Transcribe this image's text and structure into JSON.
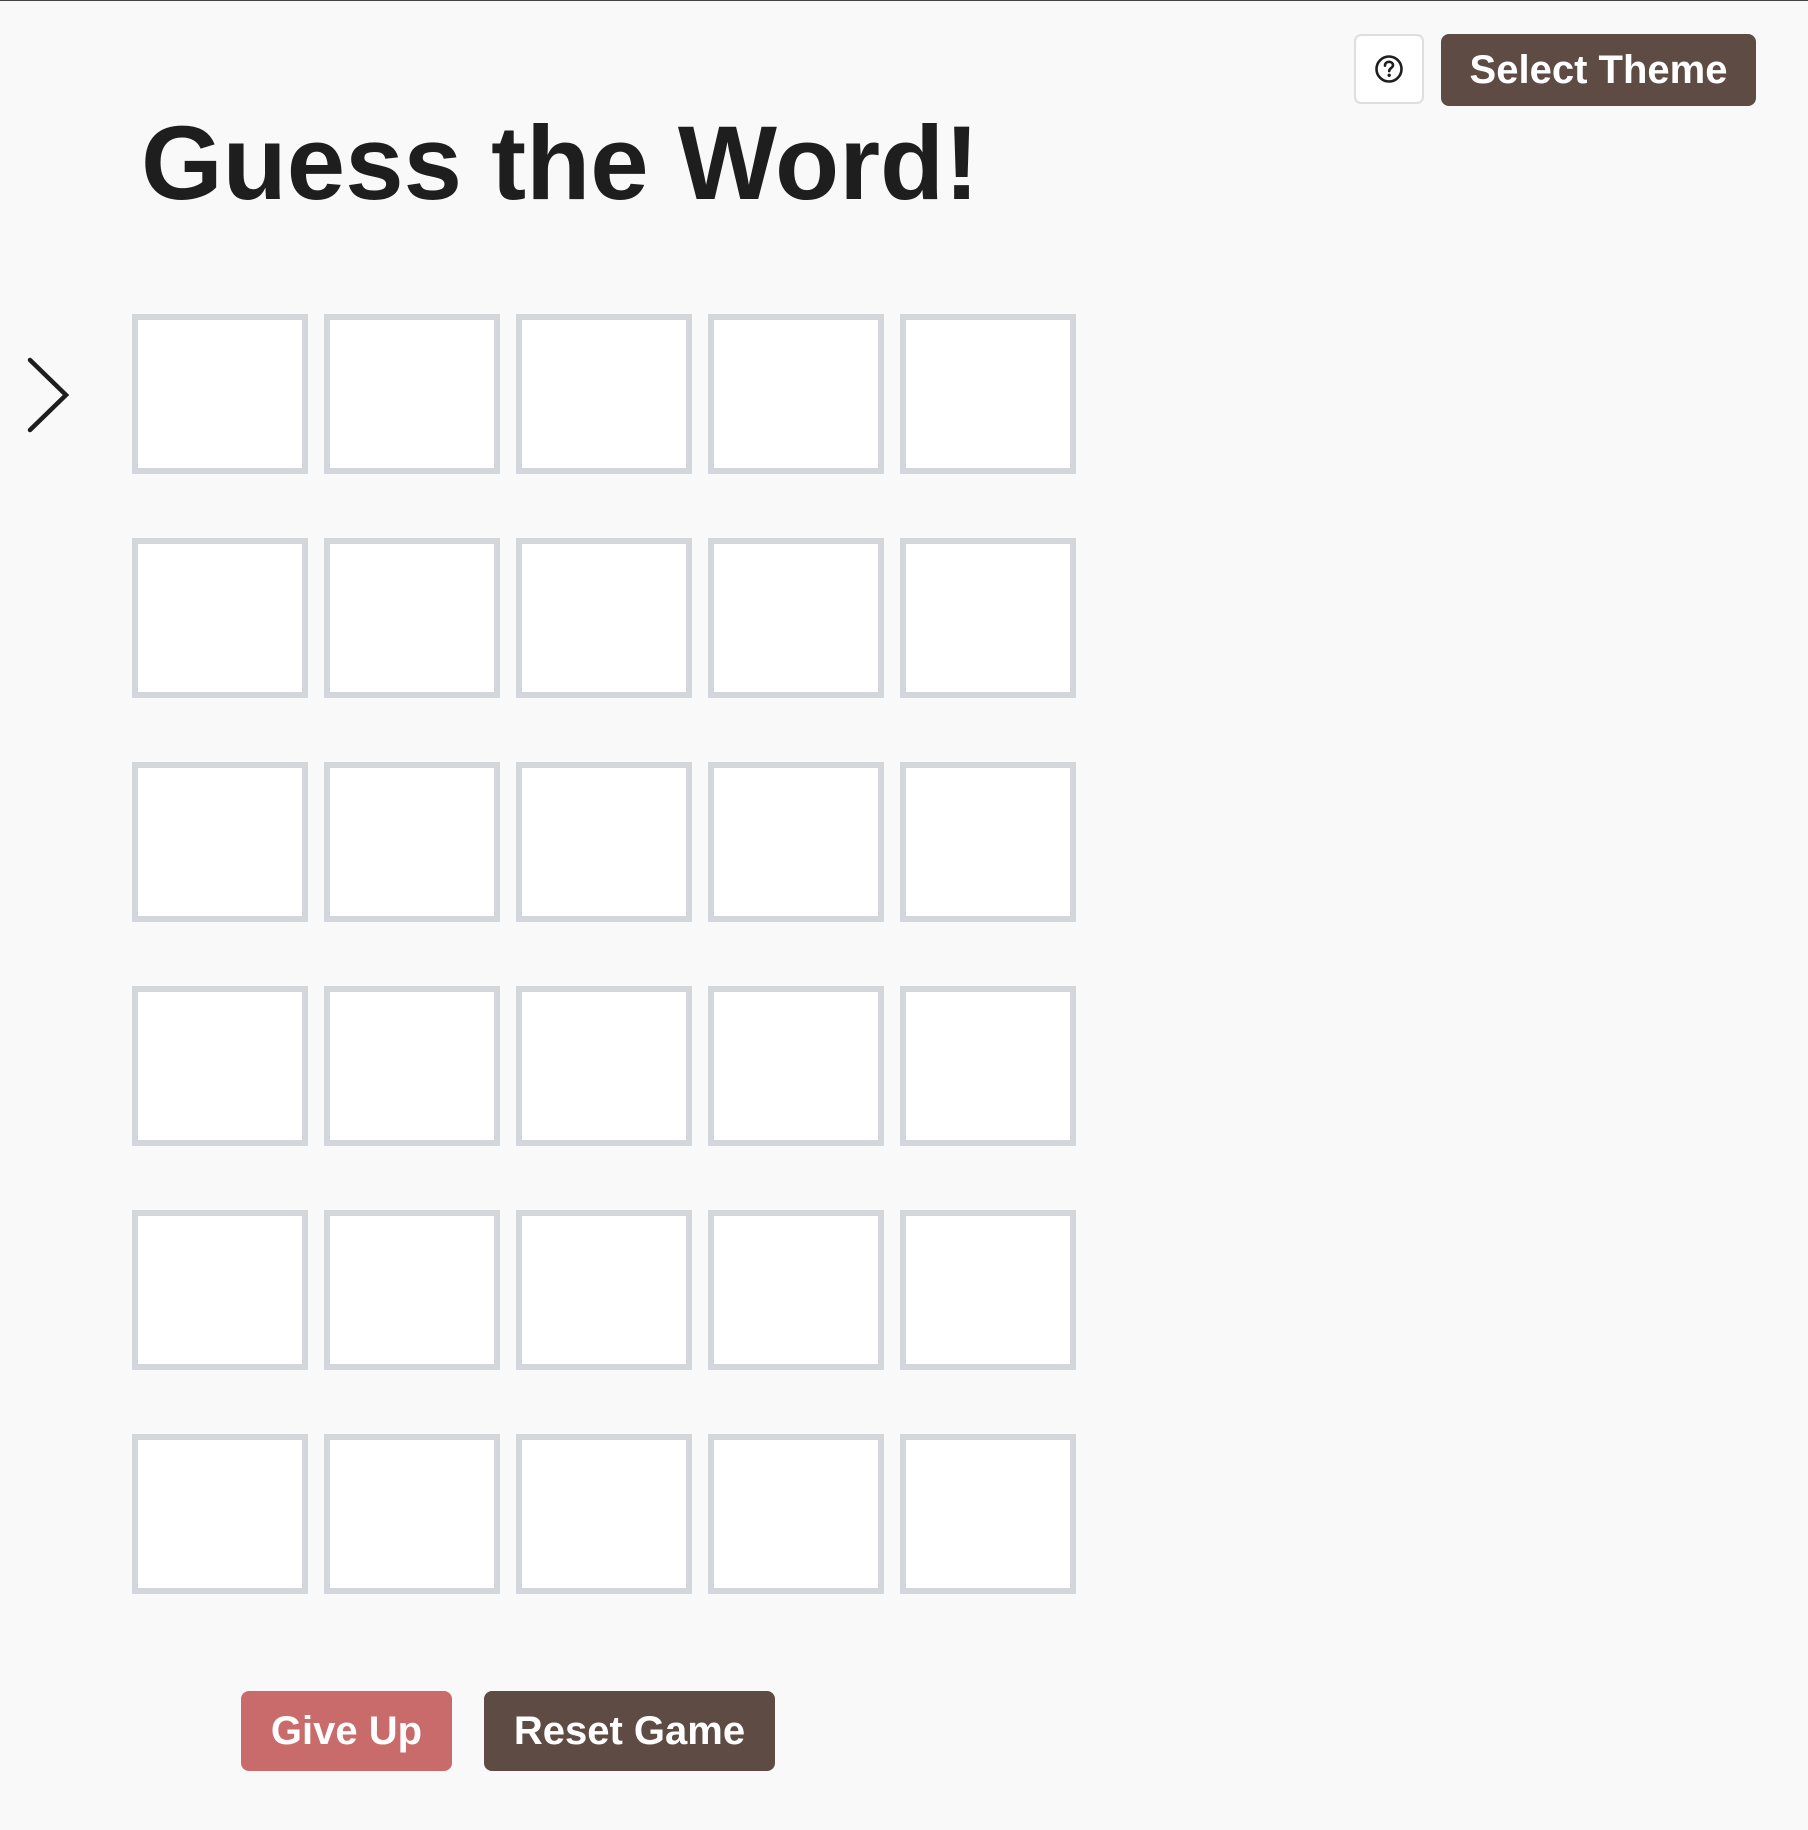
{
  "header": {
    "help_icon": "question-circle-icon",
    "select_theme_label": "Select Theme"
  },
  "title": "Guess the Word!",
  "board": {
    "current_row_indicator_icon": "chevron-right-icon",
    "rows": [
      [
        "",
        "",
        "",
        "",
        ""
      ],
      [
        "",
        "",
        "",
        "",
        ""
      ],
      [
        "",
        "",
        "",
        "",
        ""
      ],
      [
        "",
        "",
        "",
        "",
        ""
      ],
      [
        "",
        "",
        "",
        "",
        ""
      ],
      [
        "",
        "",
        "",
        "",
        ""
      ]
    ]
  },
  "actions": {
    "give_up_label": "Give Up",
    "reset_label": "Reset Game"
  },
  "colors": {
    "background": "#f9f9f9",
    "primary_button": "#5e4b43",
    "danger_button": "#c96b6a",
    "tile_border": "#d3d6db",
    "tile_fill": "#ffffff",
    "title_text": "#1e1e1e"
  }
}
